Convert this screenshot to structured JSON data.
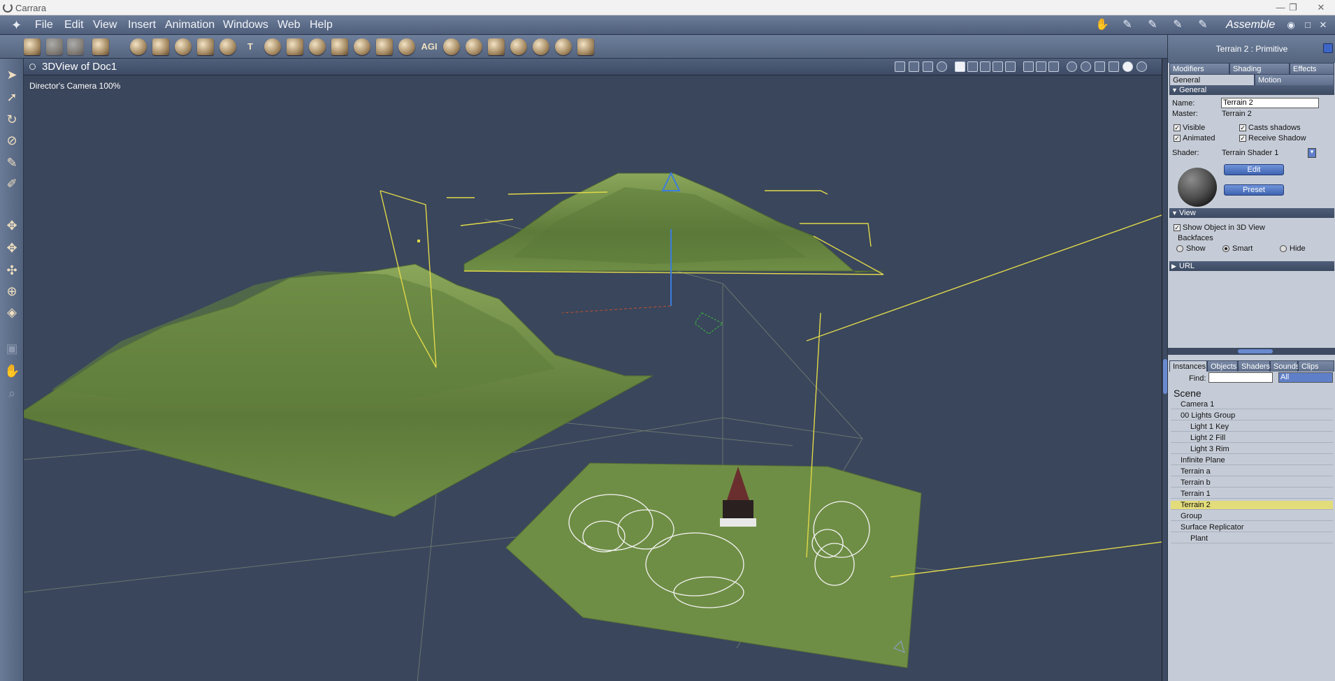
{
  "window": {
    "title": "Carrara"
  },
  "menu": [
    "File",
    "Edit",
    "View",
    "Insert",
    "Animation",
    "Windows",
    "Web",
    "Help"
  ],
  "room": "Assemble",
  "view": {
    "title": "3DView of Doc1",
    "camera_label": "Director's Camera 100%"
  },
  "panel": {
    "header": "Terrain 2 : Primitive",
    "tabs_top": [
      "Modifiers",
      "Shading",
      "Effects"
    ],
    "tabs_bottom": [
      "General",
      "Motion"
    ],
    "general": {
      "section": "General",
      "name_label": "Name:",
      "name_value": "Terrain 2",
      "master_label": "Master:",
      "master_value": "Terrain 2",
      "checks": [
        "Visible",
        "Casts shadows",
        "Animated",
        "Receive Shadow"
      ],
      "shader_label": "Shader:",
      "shader_value": "Terrain Shader 1",
      "edit": "Edit",
      "preset": "Preset"
    },
    "view_section": {
      "section": "View",
      "show_label": "Show Object in 3D View",
      "backfaces": "Backfaces",
      "options": [
        "Show",
        "Smart",
        "Hide"
      ],
      "selected": "Smart"
    },
    "url_section": "URL"
  },
  "browser": {
    "tabs": [
      "Instances",
      "Objects",
      "Shaders",
      "Sounds",
      "Clips"
    ],
    "find_label": "Find:",
    "filter": "All",
    "scene_label": "Scene",
    "items": [
      {
        "label": "Camera 1"
      },
      {
        "label": "00 Lights Group"
      },
      {
        "label": "Light 1 Key"
      },
      {
        "label": "Light 2 Fill"
      },
      {
        "label": "Light 3 Rim"
      },
      {
        "label": "Infinite Plane"
      },
      {
        "label": "Terrain a"
      },
      {
        "label": "Terrain b"
      },
      {
        "label": "Terrain 1"
      },
      {
        "label": "Terrain 2"
      },
      {
        "label": "Group"
      },
      {
        "label": "Surface Replicator"
      },
      {
        "label": "Plant"
      }
    ],
    "selected": "Terrain 2"
  },
  "colors": {
    "selection": "#e3dc7a",
    "terrain": "#6f8e45",
    "viewport": "#3a465c",
    "bbox": "#e0d84a"
  }
}
